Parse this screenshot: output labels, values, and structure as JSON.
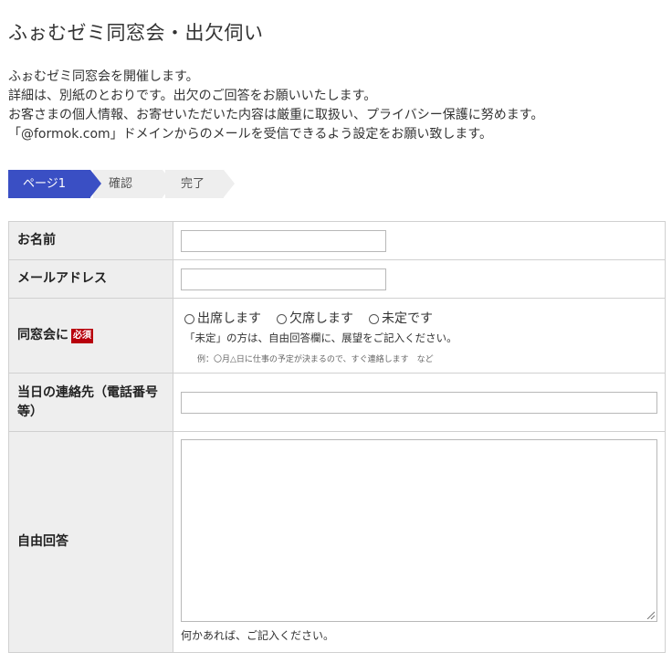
{
  "page": {
    "title": "ふぉむゼミ同窓会・出欠伺い"
  },
  "intro": [
    "ふぉむゼミ同窓会を開催します。",
    "詳細は、別紙のとおりです。出欠のご回答をお願いいたします。",
    "お客さまの個人情報、お寄せいただいた内容は厳重に取扱い、プライバシー保護に努めます。",
    "「@formok.com」ドメインからのメールを受信できるよう設定をお願い致します。"
  ],
  "steps": [
    {
      "label": "ページ1",
      "active": true
    },
    {
      "label": "確認",
      "active": false
    },
    {
      "label": "完了",
      "active": false
    }
  ],
  "colors": {
    "active_step": "#3a4fc4",
    "inactive_step": "#eeeeee",
    "required_badge": "#b8000c",
    "label_bg": "#eeeeee"
  },
  "form": {
    "name": {
      "label": "お名前",
      "value": ""
    },
    "email": {
      "label": "メールアドレス",
      "value": ""
    },
    "attendance": {
      "label": "同窓会に",
      "required_badge": "必須",
      "options": [
        "出席します",
        "欠席します",
        "未定です"
      ],
      "note": "「未定」の方は、自由回答欄に、展望をご記入ください。",
      "example": "例：〇月△日に仕事の予定が決まるので、すぐ連絡します　など"
    },
    "phone": {
      "label": "当日の連絡先（電話番号等）",
      "value": ""
    },
    "free_answer": {
      "label": "自由回答",
      "value": "",
      "note": "何かあれば、ご記入ください。"
    }
  }
}
